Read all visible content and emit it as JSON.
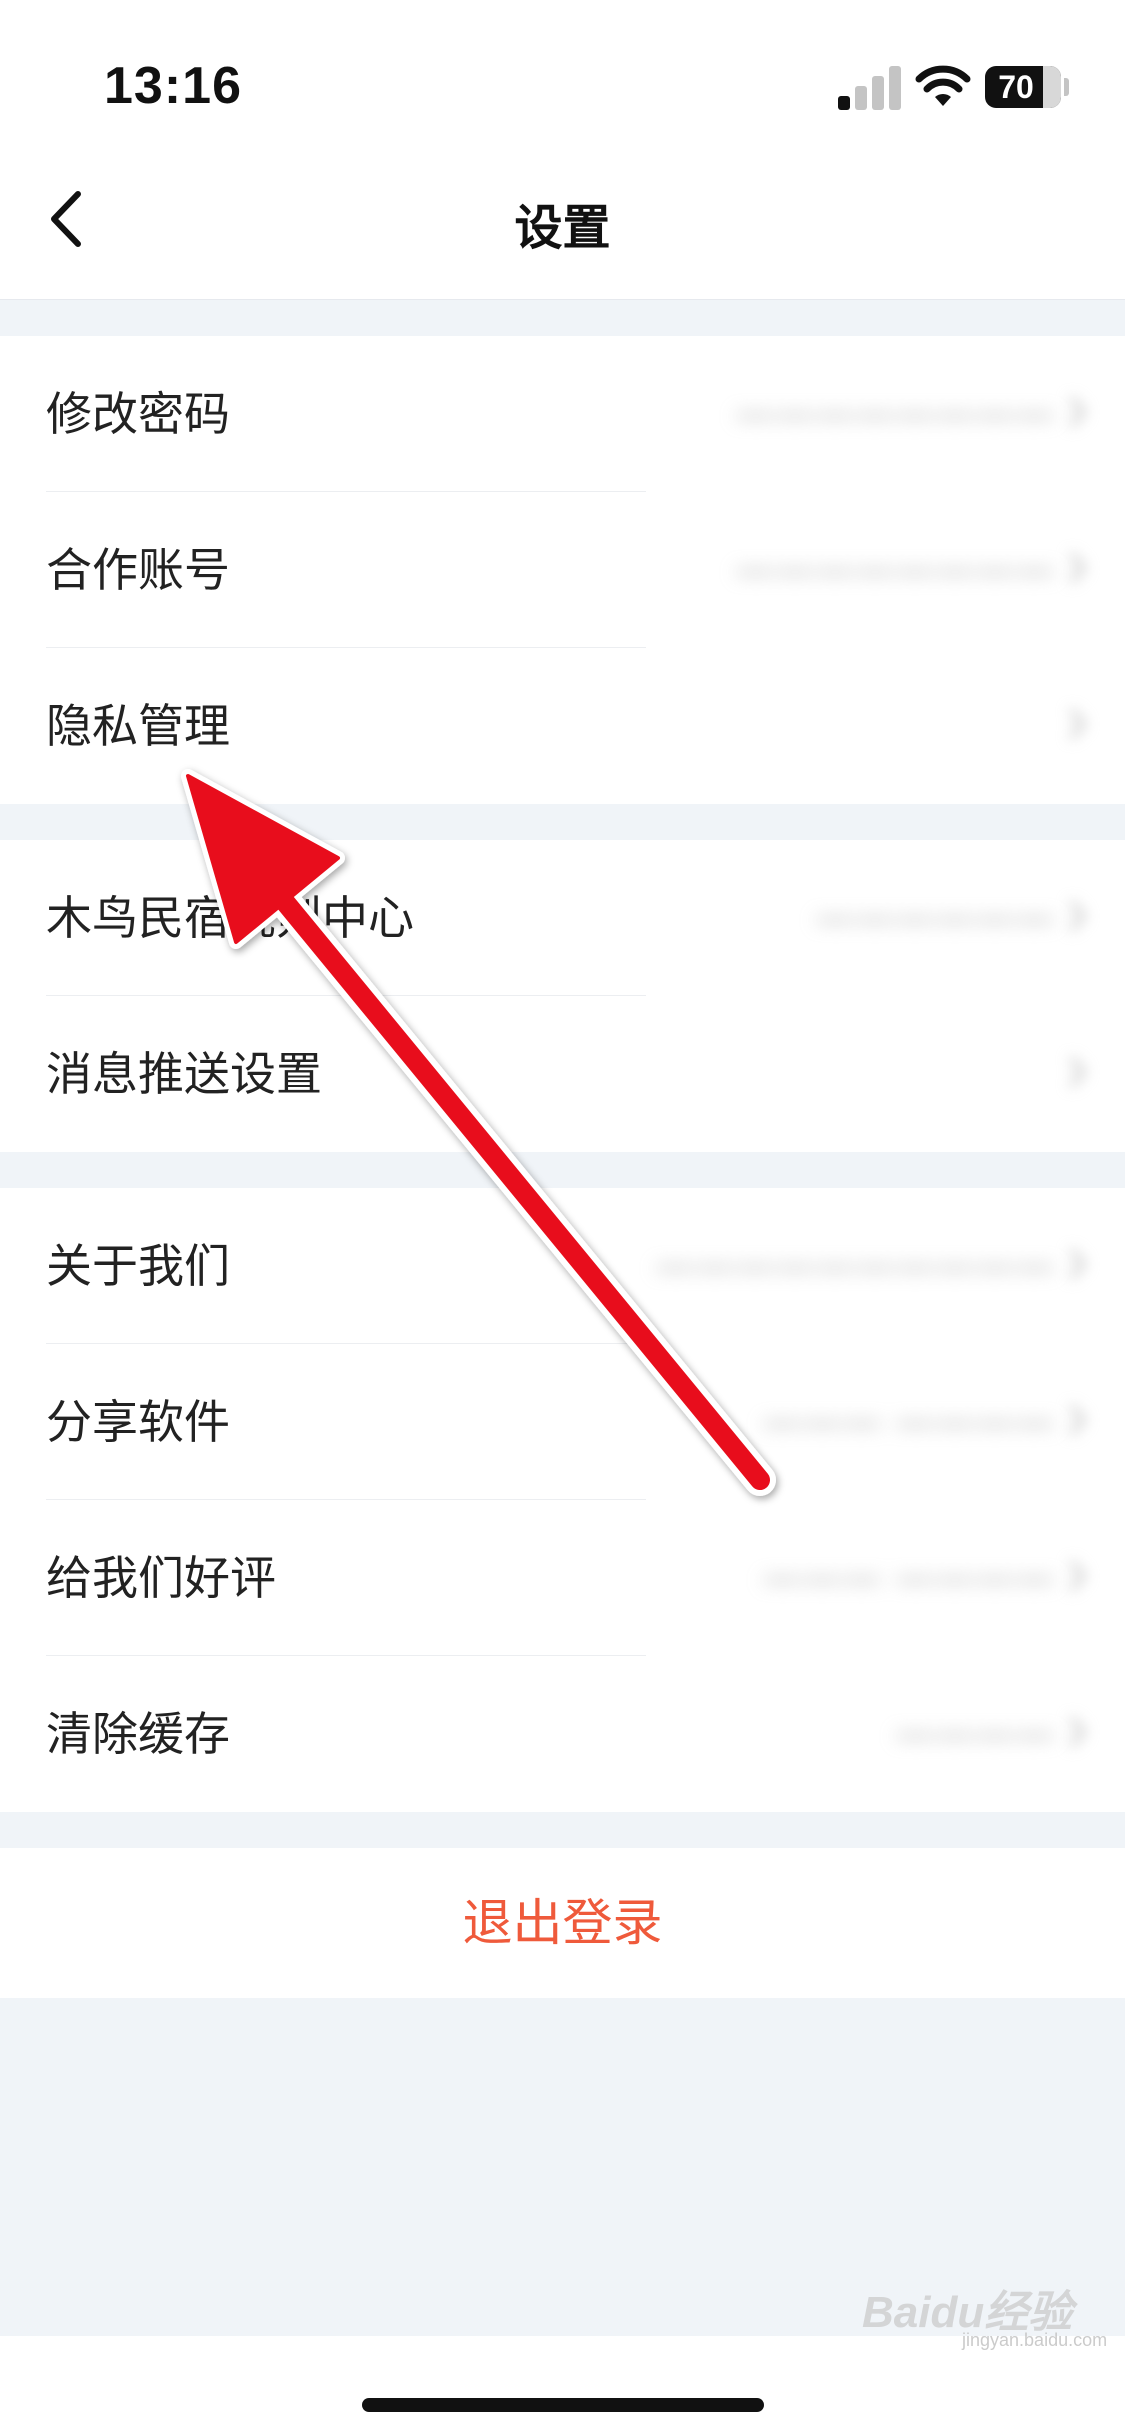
{
  "status_bar": {
    "time": "13:16",
    "battery_level": "70",
    "icons": [
      "cellular-signal-icon",
      "wifi-icon",
      "battery-icon"
    ]
  },
  "nav": {
    "title": "设置",
    "back_icon": "chevron-left-icon"
  },
  "groups": [
    {
      "items": [
        {
          "label": "修改密码",
          "value": "————————"
        },
        {
          "label": "合作账号",
          "value": "————————"
        },
        {
          "label": "隐私管理",
          "value": ""
        }
      ]
    },
    {
      "items": [
        {
          "label": "木鸟民宿规则中心",
          "value": "——————"
        },
        {
          "label": "消息推送设置",
          "value": ""
        }
      ]
    },
    {
      "items": [
        {
          "label": "关于我们",
          "value": "——————————"
        },
        {
          "label": "分享软件",
          "value": "——— ————"
        },
        {
          "label": "给我们好评",
          "value": "——— ————"
        },
        {
          "label": "清除缓存",
          "value": "————"
        }
      ]
    }
  ],
  "logout": {
    "label": "退出登录"
  },
  "colors": {
    "accent": "#ef5a3b",
    "background": "#f0f4f8",
    "annotation_arrow": "#e8101c"
  },
  "watermark": {
    "brand": "Baidu经验",
    "url": "jingyan.baidu.com"
  }
}
